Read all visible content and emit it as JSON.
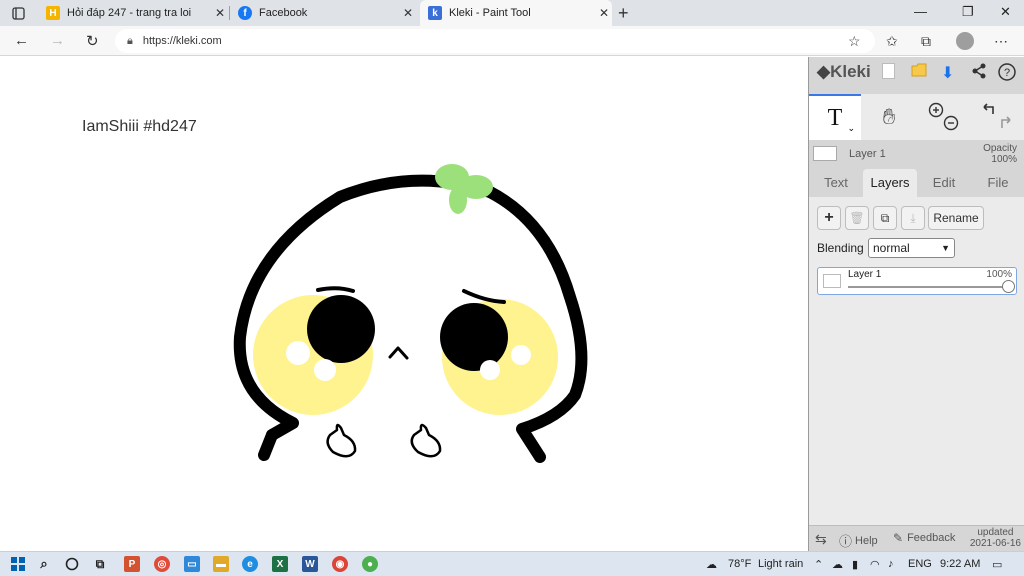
{
  "browser": {
    "tabs": [
      {
        "label": "Hỏi đáp 247 - trang tra loi",
        "favicon": "H",
        "color": "#f4b400"
      },
      {
        "label": "Facebook",
        "favicon": "f",
        "color": "#1877f2"
      },
      {
        "label": "Kleki - Paint Tool",
        "favicon": "k",
        "color": "#3b6fd8"
      }
    ],
    "url": "https://kleki.com"
  },
  "canvas": {
    "caption": "IamShiii #hd247"
  },
  "kleki": {
    "brand": "Kleki",
    "current_layer": "Layer 1",
    "opacity_label": "Opacity",
    "opacity_value": "100%",
    "tabs": [
      "Text",
      "Layers",
      "Edit",
      "File"
    ],
    "rename_label": "Rename",
    "blending_label": "Blending",
    "blending_value": "normal",
    "layer_item": {
      "name": "Layer 1",
      "opacity": "100%",
      "opacity_fraction": 1.0
    },
    "help_label": "Help",
    "feedback_label": "Feedback",
    "updated_label": "updated",
    "updated_date": "2021-06-16"
  },
  "taskbar": {
    "weather_temp": "78°F",
    "weather_desc": "Light rain",
    "lang": "ENG",
    "time": "9:22 AM"
  }
}
